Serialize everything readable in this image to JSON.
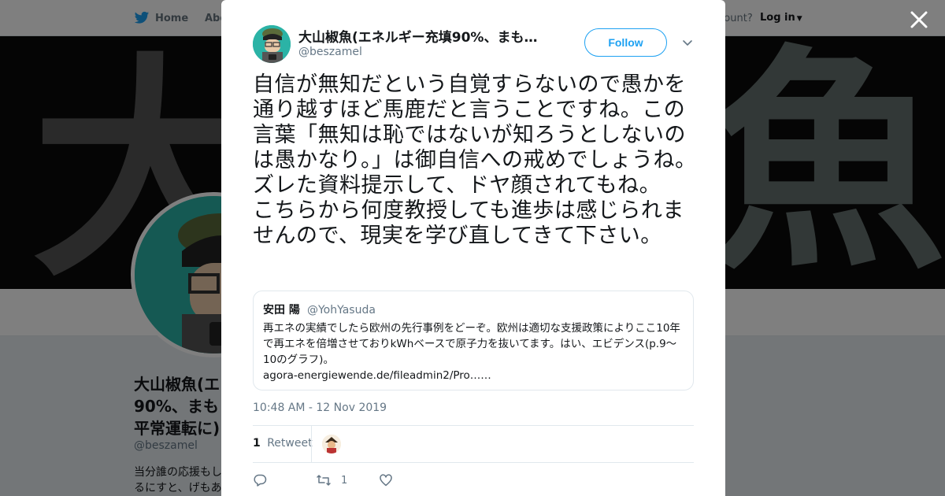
{
  "nav": {
    "home": "Home",
    "about": "Abo",
    "account_prompt": "ccount?",
    "login": "Log in"
  },
  "profile": {
    "name": "大山椒魚(エ 90%、まも 平常運転に)",
    "handle": "@beszamel",
    "bio": "当分誰の応援もし るにすと、げもあ"
  },
  "tweet": {
    "author_name": "大山椒魚(エネルギー充填90%、まも…",
    "author_handle": "@beszamel",
    "follow_label": "Follow",
    "text": [
      "自信が無知だという自覚すらないので愚かを通り越すほど馬鹿だと言うことですね。この言葉「無知は恥ではないが知ろうとしないのは愚かなり。」は御自信への戒めでしょうね。",
      "ズレた資料提示して、ドヤ顔されてもね。",
      "こちらから何度教授しても進歩は感じられませんので、現実を学び直してきて下さい。"
    ],
    "quoted": {
      "name": "安田 陽",
      "handle": "@YohYasuda",
      "text": "再エネの実績でしたら欧州の先行事例をどーぞ。欧州は適切な支援政策によりここ10年で再エネを倍増させておりkWhベースで原子力を抜いてます。はい、エビデンス(p.9〜10のグラフ)。",
      "link": "agora-energiewende.de/fileadmin2/Pro……"
    },
    "timestamp": "10:48 AM - 12 Nov 2019",
    "retweet_count": "1",
    "retweet_label": "Retweet",
    "action_retweet_count": "1"
  },
  "colors": {
    "twitter_blue": "#1da1f2",
    "text_primary": "#14171a",
    "text_secondary": "#657786",
    "avatar_teal": "#2bb3a6"
  },
  "icons": [
    "twitter-bird-icon",
    "caret-down-icon",
    "close-icon",
    "chevron-down-icon",
    "reply-icon",
    "retweet-icon",
    "like-icon"
  ]
}
